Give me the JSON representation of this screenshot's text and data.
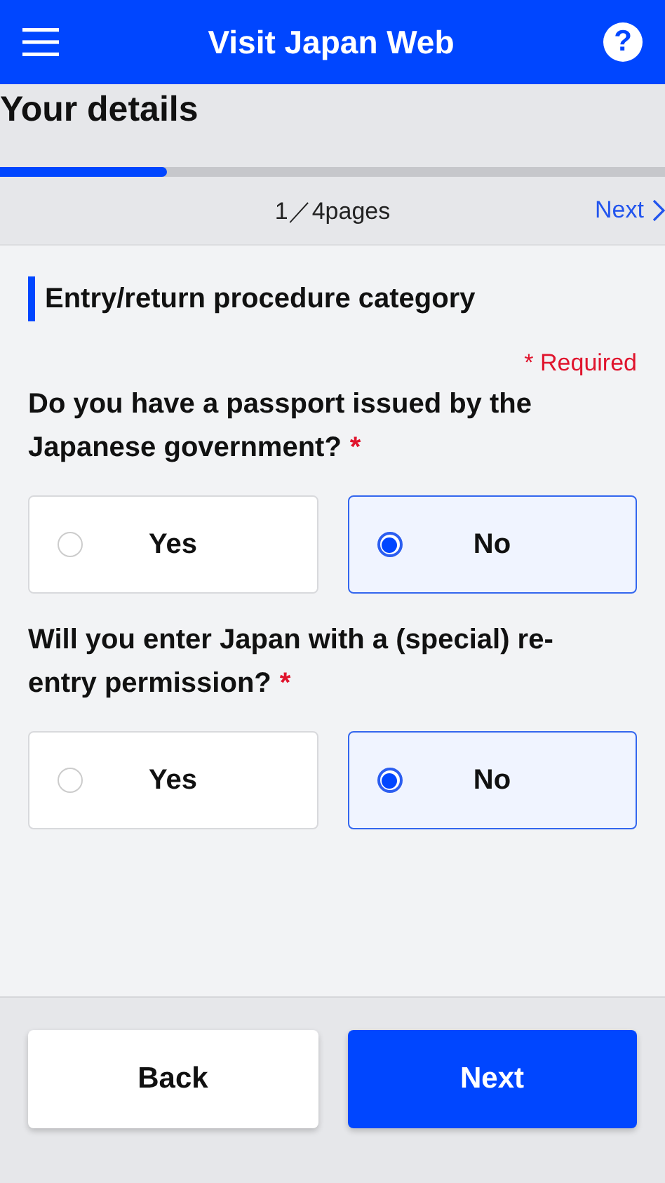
{
  "header": {
    "title": "Visit Japan Web",
    "help": "?"
  },
  "page_title": "Your details",
  "progress": {
    "level": 0.25
  },
  "pager": {
    "count": "1／4pages",
    "next": "Next"
  },
  "section": {
    "title": "Entry/return procedure category"
  },
  "required_note": "* Required",
  "questions": [
    {
      "text": "Do you have a passport issued by the Japanese government?",
      "mark": "*",
      "options": [
        {
          "label": "Yes",
          "selected": false
        },
        {
          "label": "No",
          "selected": true
        }
      ]
    },
    {
      "text": "Will you enter Japan with a (special) re-entry permission?",
      "mark": "*",
      "options": [
        {
          "label": "Yes",
          "selected": false
        },
        {
          "label": "No",
          "selected": true
        }
      ]
    }
  ],
  "footer": {
    "buttons": [
      {
        "label": "Back",
        "kind": "secondary"
      },
      {
        "label": "Next",
        "kind": "primary"
      }
    ]
  }
}
